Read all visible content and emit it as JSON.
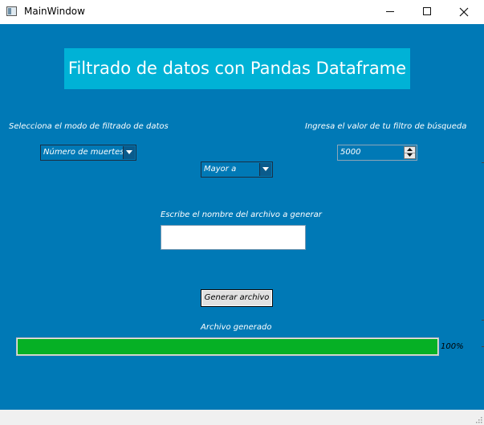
{
  "window": {
    "title": "MainWindow"
  },
  "heading": "Filtrado de datos con Pandas Dataframe",
  "filter_mode": {
    "label": "Selecciona el modo de filtrado de datos",
    "selected": "Número de muertes"
  },
  "comparison": {
    "selected": "Mayor a"
  },
  "filter_value": {
    "label": "Ingresa el valor de tu filtro de búsqueda",
    "value": "5000"
  },
  "file_name": {
    "label": "Escribe el nombre del archivo a generar",
    "value": ""
  },
  "generate_button": {
    "label": "Generar archivo"
  },
  "status": {
    "label": "Archivo generado",
    "progress": 100,
    "progress_text": "100%"
  },
  "colors": {
    "background": "#0079b6",
    "heading_background": "#00b2d6",
    "progress_fill": "#06b025"
  }
}
